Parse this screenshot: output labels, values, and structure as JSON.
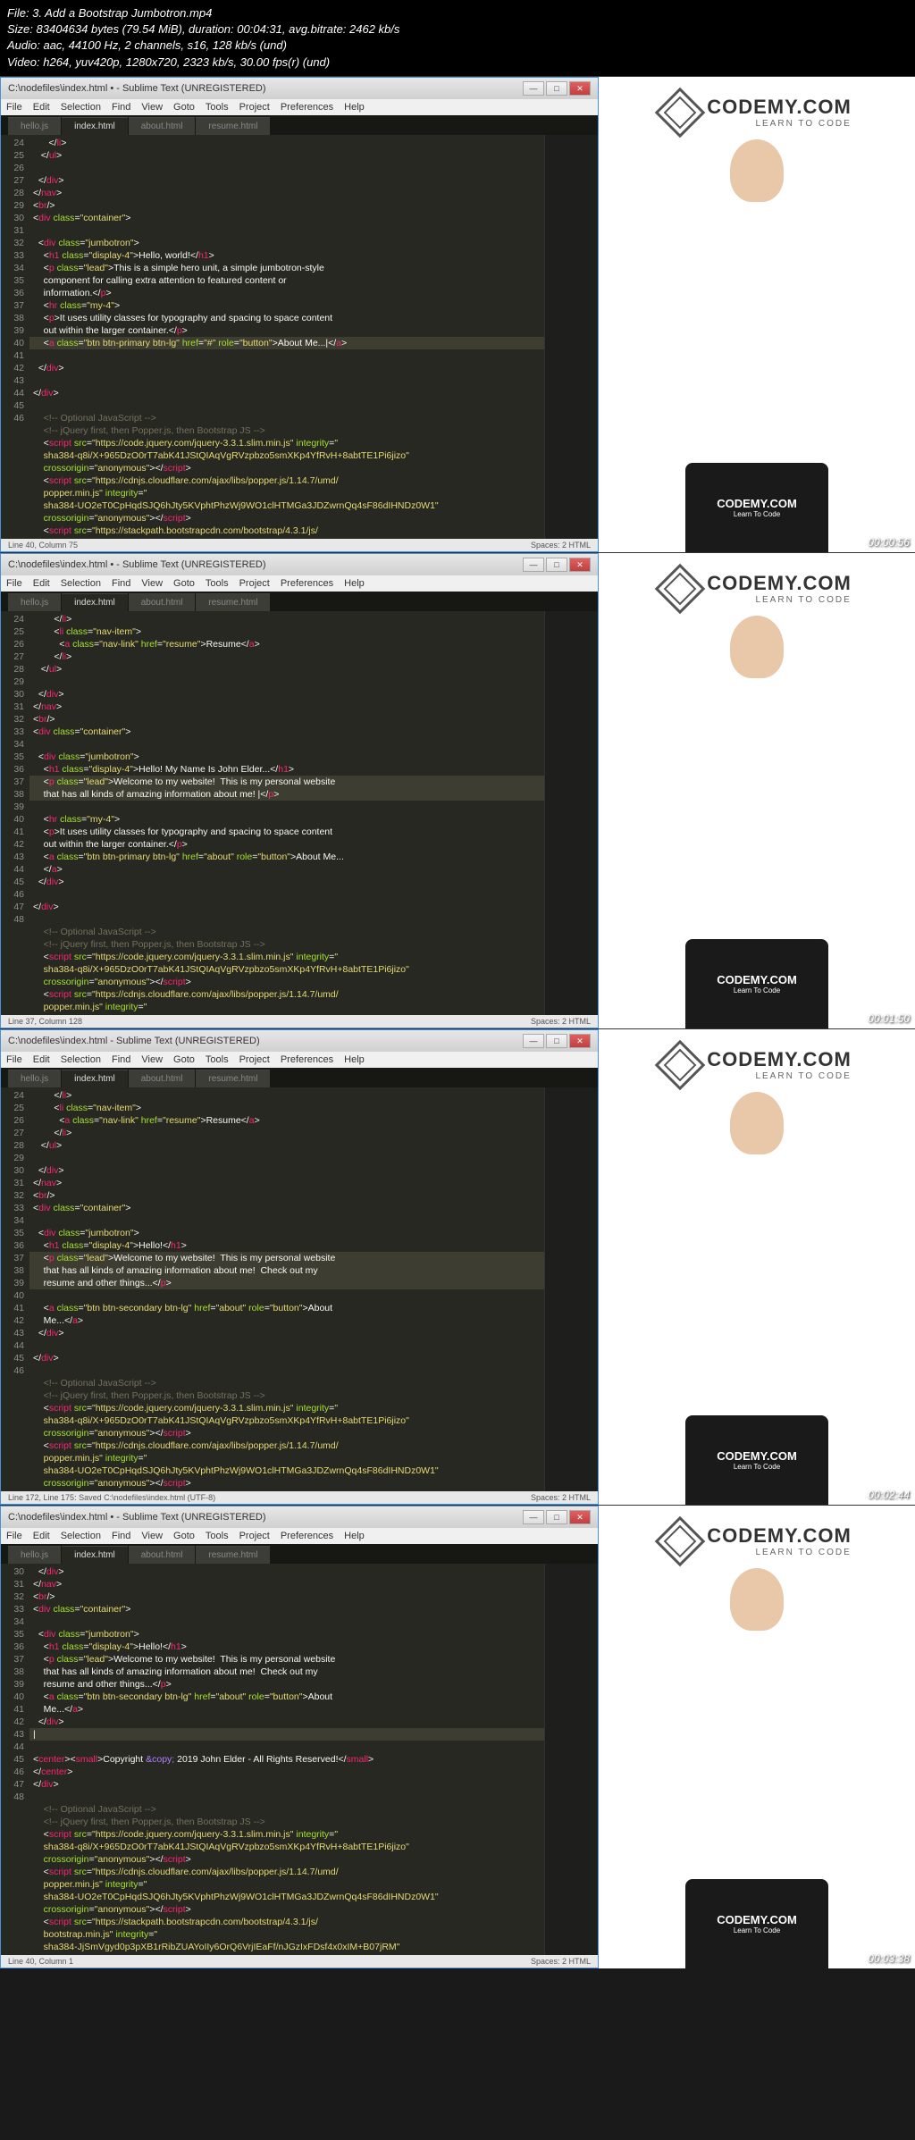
{
  "meta": {
    "file": "File: 3. Add a Bootstrap Jumbotron.mp4",
    "size": "Size: 83404634 bytes (79.54 MiB), duration: 00:04:31, avg.bitrate: 2462 kb/s",
    "audio": "Audio: aac, 44100 Hz, 2 channels, s16, 128 kb/s (und)",
    "video": "Video: h264, yuv420p, 1280x720, 2323 kb/s, 30.00 fps(r) (und)"
  },
  "menus": [
    "File",
    "Edit",
    "Selection",
    "Find",
    "View",
    "Goto",
    "Tools",
    "Project",
    "Preferences",
    "Help"
  ],
  "tabs": [
    "hello.js",
    "index.html",
    "about.html",
    "resume.html"
  ],
  "logo": {
    "main": "CODEMY.COM",
    "sub": "LEARN TO CODE"
  },
  "tshirt": {
    "main": "CODEMY.COM",
    "sub": "Learn To Code"
  },
  "frames": [
    {
      "title": "C:\\nodefiles\\index.html • - Sublime Text (UNREGISTERED)",
      "timestamp": "00:00:56",
      "status_left": "Line 40, Column 75",
      "status_right": "Spaces: 2    HTML",
      "start": 24,
      "code": [
        "      <span class='t-white'>&lt;/</span><span class='t-red'>li</span><span class='t-white'>&gt;</span>",
        "   <span class='t-white'>&lt;/</span><span class='t-red'>ul</span><span class='t-white'>&gt;</span>",
        "",
        "  <span class='t-white'>&lt;/</span><span class='t-red'>div</span><span class='t-white'>&gt;</span>",
        "<span class='t-white'>&lt;/</span><span class='t-red'>nav</span><span class='t-white'>&gt;</span>",
        "<span class='t-white'>&lt;</span><span class='t-red'>br</span><span class='t-white'>/&gt;</span>",
        "<span class='t-white'>&lt;</span><span class='t-red'>div</span> <span class='t-green'>class</span>=<span class='t-yellow'>\"container\"</span><span class='t-white'>&gt;</span>",
        "",
        "  <span class='t-white'>&lt;</span><span class='t-red'>div</span> <span class='t-green'>class</span>=<span class='t-yellow'>\"jumbotron\"</span><span class='t-white'>&gt;</span>",
        "    <span class='t-white'>&lt;</span><span class='t-red'>h1</span> <span class='t-green'>class</span>=<span class='t-yellow'>\"display-4\"</span><span class='t-white'>&gt;Hello, world!&lt;/</span><span class='t-red'>h1</span><span class='t-white'>&gt;</span>",
        "    <span class='t-white'>&lt;</span><span class='t-red'>p</span> <span class='t-green'>class</span>=<span class='t-yellow'>\"lead\"</span><span class='t-white'>&gt;This is a simple hero unit, a simple jumbotron-style</span>\n    <span class='t-white'>component for calling extra attention to featured content or</span>\n    <span class='t-white'>information.&lt;/</span><span class='t-red'>p</span><span class='t-white'>&gt;</span>",
        "    <span class='t-white'>&lt;</span><span class='t-red'>hr</span> <span class='t-green'>class</span>=<span class='t-yellow'>\"my-4\"</span><span class='t-white'>&gt;</span>",
        "    <span class='t-white'>&lt;</span><span class='t-red'>p</span><span class='t-white'>&gt;It uses utility classes for typography and spacing to space content</span>\n    <span class='t-white'>out within the larger container.&lt;/</span><span class='t-red'>p</span><span class='t-white'>&gt;</span>",
        "<span class='hl-line'>    <span class='t-white'>&lt;</span><span class='t-red'>a</span> <span class='t-green'>class</span>=<span class='t-yellow'>\"btn btn-primary btn-lg\"</span> <span class='t-green'>href</span>=<span class='t-yellow'>\"#\"</span> <span class='t-green'>role</span>=<span class='t-yellow'>\"button\"</span><span class='t-white'>&gt;About Me...|&lt;/</span><span class='t-red'>a</span><span class='t-white'>&gt;</span></span>",
        "  <span class='t-white'>&lt;/</span><span class='t-red'>div</span><span class='t-white'>&gt;</span>",
        "",
        "<span class='t-white'>&lt;/</span><span class='t-red'>div</span><span class='t-white'>&gt;</span>",
        "",
        "    <span class='t-comment'>&lt;!-- Optional JavaScript --&gt;</span>",
        "    <span class='t-comment'>&lt;!-- jQuery first, then Popper.js, then Bootstrap JS --&gt;</span>",
        "    <span class='t-white'>&lt;</span><span class='t-red'>script</span> <span class='t-green'>src</span>=<span class='t-yellow'>\"https://code.jquery.com/jquery-3.3.1.slim.min.js\"</span> <span class='t-green'>integrity</span>=<span class='t-yellow'>\"</span>\n    <span class='t-yellow'>sha384-q8i/X+965DzO0rT7abK41JStQIAqVgRVzpbzo5smXKp4YfRvH+8abtTE1Pi6jizo\"</span>\n    <span class='t-green'>crossorigin</span>=<span class='t-yellow'>\"anonymous\"</span><span class='t-white'>&gt;&lt;/</span><span class='t-red'>script</span><span class='t-white'>&gt;</span>",
        "    <span class='t-white'>&lt;</span><span class='t-red'>script</span> <span class='t-green'>src</span>=<span class='t-yellow'>\"https://cdnjs.cloudflare.com/ajax/libs/popper.js/1.14.7/umd/</span>\n    <span class='t-yellow'>popper.min.js\"</span> <span class='t-green'>integrity</span>=<span class='t-yellow'>\"</span>\n    <span class='t-yellow'>sha384-UO2eT0CpHqdSJQ6hJty5KVphtPhzWj9WO1clHTMGa3JDZwrnQq4sF86dIHNDz0W1\"</span>\n    <span class='t-green'>crossorigin</span>=<span class='t-yellow'>\"anonymous\"</span><span class='t-white'>&gt;&lt;/</span><span class='t-red'>script</span><span class='t-white'>&gt;</span>",
        "    <span class='t-white'>&lt;</span><span class='t-red'>script</span> <span class='t-green'>src</span>=<span class='t-yellow'>\"https://stackpath.bootstrapcdn.com/bootstrap/4.3.1/js/</span>"
      ]
    },
    {
      "title": "C:\\nodefiles\\index.html • - Sublime Text (UNREGISTERED)",
      "timestamp": "00:01:50",
      "status_left": "Line 37, Column 128",
      "status_right": "Spaces: 2    HTML",
      "start": 24,
      "code": [
        "        <span class='t-white'>&lt;/</span><span class='t-red'>li</span><span class='t-white'>&gt;</span>",
        "        <span class='t-white'>&lt;</span><span class='t-red'>li</span> <span class='t-green'>class</span>=<span class='t-yellow'>\"nav-item\"</span><span class='t-white'>&gt;</span>",
        "          <span class='t-white'>&lt;</span><span class='t-red'>a</span> <span class='t-green'>class</span>=<span class='t-yellow'>\"nav-link\"</span> <span class='t-green'>href</span>=<span class='t-yellow'>\"resume\"</span><span class='t-white'>&gt;Resume&lt;/</span><span class='t-red'>a</span><span class='t-white'>&gt;</span>",
        "        <span class='t-white'>&lt;/</span><span class='t-red'>li</span><span class='t-white'>&gt;</span>",
        "   <span class='t-white'>&lt;/</span><span class='t-red'>ul</span><span class='t-white'>&gt;</span>",
        "",
        "  <span class='t-white'>&lt;/</span><span class='t-red'>div</span><span class='t-white'>&gt;</span>",
        "<span class='t-white'>&lt;/</span><span class='t-red'>nav</span><span class='t-white'>&gt;</span>",
        "<span class='t-white'>&lt;</span><span class='t-red'>br</span><span class='t-white'>/&gt;</span>",
        "<span class='t-white'>&lt;</span><span class='t-red'>div</span> <span class='t-green'>class</span>=<span class='t-yellow'>\"container\"</span><span class='t-white'>&gt;</span>",
        "",
        "  <span class='t-white'>&lt;</span><span class='t-red'>div</span> <span class='t-green'>class</span>=<span class='t-yellow'>\"jumbotron\"</span><span class='t-white'>&gt;</span>",
        "    <span class='t-white'>&lt;</span><span class='t-red'>h1</span> <span class='t-green'>class</span>=<span class='t-yellow'>\"display-4\"</span><span class='t-white'>&gt;Hello! My Name Is John Elder...&lt;/</span><span class='t-red'>h1</span><span class='t-white'>&gt;</span>",
        "<span class='hl-line'>    <span class='t-white'>&lt;</span><span class='t-red'>p</span> <span class='t-green'>class</span>=<span class='t-yellow'>\"lead\"</span><span class='t-white'>&gt;Welcome to my website!  This is my personal website</span>\n    <span class='t-white'>that has all kinds of amazing information about me! |&lt;/</span><span class='t-red'>p</span><span class='t-white'>&gt;</span></span>",
        "    <span class='t-white'>&lt;</span><span class='t-red'>hr</span> <span class='t-green'>class</span>=<span class='t-yellow'>\"my-4\"</span><span class='t-white'>&gt;</span>",
        "    <span class='t-white'>&lt;</span><span class='t-red'>p</span><span class='t-white'>&gt;It uses utility classes for typography and spacing to space content</span>\n    <span class='t-white'>out within the larger container.&lt;/</span><span class='t-red'>p</span><span class='t-white'>&gt;</span>",
        "    <span class='t-white'>&lt;</span><span class='t-red'>a</span> <span class='t-green'>class</span>=<span class='t-yellow'>\"btn btn-primary btn-lg\"</span> <span class='t-green'>href</span>=<span class='t-yellow'>\"about\"</span> <span class='t-green'>role</span>=<span class='t-yellow'>\"button\"</span><span class='t-white'>&gt;About Me...</span>\n    <span class='t-white'>&lt;/</span><span class='t-red'>a</span><span class='t-white'>&gt;</span>",
        "  <span class='t-white'>&lt;/</span><span class='t-red'>div</span><span class='t-white'>&gt;</span>",
        "",
        "<span class='t-white'>&lt;/</span><span class='t-red'>div</span><span class='t-white'>&gt;</span>",
        "",
        "    <span class='t-comment'>&lt;!-- Optional JavaScript --&gt;</span>",
        "    <span class='t-comment'>&lt;!-- jQuery first, then Popper.js, then Bootstrap JS --&gt;</span>",
        "    <span class='t-white'>&lt;</span><span class='t-red'>script</span> <span class='t-green'>src</span>=<span class='t-yellow'>\"https://code.jquery.com/jquery-3.3.1.slim.min.js\"</span> <span class='t-green'>integrity</span>=<span class='t-yellow'>\"</span>\n    <span class='t-yellow'>sha384-q8i/X+965DzO0rT7abK41JStQIAqVgRVzpbzo5smXKp4YfRvH+8abtTE1Pi6jizo\"</span>\n    <span class='t-green'>crossorigin</span>=<span class='t-yellow'>\"anonymous\"</span><span class='t-white'>&gt;&lt;/</span><span class='t-red'>script</span><span class='t-white'>&gt;</span>",
        "    <span class='t-white'>&lt;</span><span class='t-red'>script</span> <span class='t-green'>src</span>=<span class='t-yellow'>\"https://cdnjs.cloudflare.com/ajax/libs/popper.js/1.14.7/umd/</span>\n    <span class='t-yellow'>popper.min.js\"</span> <span class='t-green'>integrity</span>=<span class='t-yellow'>\"</span>"
      ]
    },
    {
      "title": "C:\\nodefiles\\index.html - Sublime Text (UNREGISTERED)",
      "timestamp": "00:02:44",
      "status_left": "Line 172, Line 175: Saved C:\\nodefiles\\index.html (UTF-8)",
      "status_right": "Spaces: 2    HTML",
      "start": 24,
      "code": [
        "        <span class='t-white'>&lt;/</span><span class='t-red'>li</span><span class='t-white'>&gt;</span>",
        "        <span class='t-white'>&lt;</span><span class='t-red'>li</span> <span class='t-green'>class</span>=<span class='t-yellow'>\"nav-item\"</span><span class='t-white'>&gt;</span>",
        "          <span class='t-white'>&lt;</span><span class='t-red'>a</span> <span class='t-green'>class</span>=<span class='t-yellow'>\"nav-link\"</span> <span class='t-green'>href</span>=<span class='t-yellow'>\"resume\"</span><span class='t-white'>&gt;Resume&lt;/</span><span class='t-red'>a</span><span class='t-white'>&gt;</span>",
        "        <span class='t-white'>&lt;/</span><span class='t-red'>li</span><span class='t-white'>&gt;</span>",
        "   <span class='t-white'>&lt;/</span><span class='t-red'>ul</span><span class='t-white'>&gt;</span>",
        "",
        "  <span class='t-white'>&lt;/</span><span class='t-red'>div</span><span class='t-white'>&gt;</span>",
        "<span class='t-white'>&lt;/</span><span class='t-red'>nav</span><span class='t-white'>&gt;</span>",
        "<span class='t-white'>&lt;</span><span class='t-red'>br</span><span class='t-white'>/&gt;</span>",
        "<span class='t-white'>&lt;</span><span class='t-red'>div</span> <span class='t-green'>class</span>=<span class='t-yellow'>\"container\"</span><span class='t-white'>&gt;</span>",
        "",
        "  <span class='t-white'>&lt;</span><span class='t-red'>div</span> <span class='t-green'>class</span>=<span class='t-yellow'>\"jumbotron\"</span><span class='t-white'>&gt;</span>",
        "    <span class='t-white'>&lt;</span><span class='t-red'>h1</span> <span class='t-green'>class</span>=<span class='t-yellow'>\"display-4\"</span><span class='t-white'>&gt;Hello!&lt;/</span><span class='t-red'>h1</span><span class='t-white'>&gt;</span>",
        "<span class='hl-line'>    <span class='t-white'>&lt;</span><span class='t-red'>p</span> <span class='t-green'>class</span>=<span class='t-yellow'>\"lead\"</span><span class='t-white'>&gt;Welcome to my website!  This is my personal website</span>\n    <span class='t-white'>that has all kinds of amazing information about me!  Check out my</span>\n    <span class='t-white'>resume and other things...&lt;/</span><span class='t-red'>p</span><span class='t-white'>&gt;</span></span>",
        "    <span class='t-white'>&lt;</span><span class='t-red'>a</span> <span class='t-green'>class</span>=<span class='t-yellow'>\"btn btn-secondary btn-lg\"</span> <span class='t-green'>href</span>=<span class='t-yellow'>\"about\"</span> <span class='t-green'>role</span>=<span class='t-yellow'>\"button\"</span><span class='t-white'>&gt;About</span>\n    <span class='t-white'>Me...&lt;/</span><span class='t-red'>a</span><span class='t-white'>&gt;</span>",
        "  <span class='t-white'>&lt;/</span><span class='t-red'>div</span><span class='t-white'>&gt;</span>",
        "",
        "<span class='t-white'>&lt;/</span><span class='t-red'>div</span><span class='t-white'>&gt;</span>",
        "",
        "    <span class='t-comment'>&lt;!-- Optional JavaScript --&gt;</span>",
        "    <span class='t-comment'>&lt;!-- jQuery first, then Popper.js, then Bootstrap JS --&gt;</span>",
        "    <span class='t-white'>&lt;</span><span class='t-red'>script</span> <span class='t-green'>src</span>=<span class='t-yellow'>\"https://code.jquery.com/jquery-3.3.1.slim.min.js\"</span> <span class='t-green'>integrity</span>=<span class='t-yellow'>\"</span>\n    <span class='t-yellow'>sha384-q8i/X+965DzO0rT7abK41JStQIAqVgRVzpbzo5smXKp4YfRvH+8abtTE1Pi6jizo\"</span>\n    <span class='t-green'>crossorigin</span>=<span class='t-yellow'>\"anonymous\"</span><span class='t-white'>&gt;&lt;/</span><span class='t-red'>script</span><span class='t-white'>&gt;</span>",
        "    <span class='t-white'>&lt;</span><span class='t-red'>script</span> <span class='t-green'>src</span>=<span class='t-yellow'>\"https://cdnjs.cloudflare.com/ajax/libs/popper.js/1.14.7/umd/</span>\n    <span class='t-yellow'>popper.min.js\"</span> <span class='t-green'>integrity</span>=<span class='t-yellow'>\"</span>\n    <span class='t-yellow'>sha384-UO2eT0CpHqdSJQ6hJty5KVphtPhzWj9WO1clHTMGa3JDZwrnQq4sF86dIHNDz0W1\"</span>\n    <span class='t-green'>crossorigin</span>=<span class='t-yellow'>\"anonymous\"</span><span class='t-white'>&gt;&lt;/</span><span class='t-red'>script</span><span class='t-white'>&gt;</span>"
      ]
    },
    {
      "title": "C:\\nodefiles\\index.html • - Sublime Text (UNREGISTERED)",
      "timestamp": "00:03:38",
      "status_left": "Line 40, Column 1",
      "status_right": "Spaces: 2    HTML",
      "start": 30,
      "code": [
        "  <span class='t-white'>&lt;/</span><span class='t-red'>div</span><span class='t-white'>&gt;</span>",
        "<span class='t-white'>&lt;/</span><span class='t-red'>nav</span><span class='t-white'>&gt;</span>",
        "<span class='t-white'>&lt;</span><span class='t-red'>br</span><span class='t-white'>/&gt;</span>",
        "<span class='t-white'>&lt;</span><span class='t-red'>div</span> <span class='t-green'>class</span>=<span class='t-yellow'>\"container\"</span><span class='t-white'>&gt;</span>",
        "",
        "  <span class='t-white'>&lt;</span><span class='t-red'>div</span> <span class='t-green'>class</span>=<span class='t-yellow'>\"jumbotron\"</span><span class='t-white'>&gt;</span>",
        "    <span class='t-white'>&lt;</span><span class='t-red'>h1</span> <span class='t-green'>class</span>=<span class='t-yellow'>\"display-4\"</span><span class='t-white'>&gt;Hello!&lt;/</span><span class='t-red'>h1</span><span class='t-white'>&gt;</span>",
        "    <span class='t-white'>&lt;</span><span class='t-red'>p</span> <span class='t-green'>class</span>=<span class='t-yellow'>\"lead\"</span><span class='t-white'>&gt;Welcome to my website!  This is my personal website</span>\n    <span class='t-white'>that has all kinds of amazing information about me!  Check out my</span>\n    <span class='t-white'>resume and other things...&lt;/</span><span class='t-red'>p</span><span class='t-white'>&gt;</span>",
        "    <span class='t-white'>&lt;</span><span class='t-red'>a</span> <span class='t-green'>class</span>=<span class='t-yellow'>\"btn btn-secondary btn-lg\"</span> <span class='t-green'>href</span>=<span class='t-yellow'>\"about\"</span> <span class='t-green'>role</span>=<span class='t-yellow'>\"button\"</span><span class='t-white'>&gt;About</span>\n    <span class='t-white'>Me...&lt;/</span><span class='t-red'>a</span><span class='t-white'>&gt;</span>",
        "  <span class='t-white'>&lt;/</span><span class='t-red'>div</span><span class='t-white'>&gt;</span>",
        "<span class='hl-line'>|</span>",
        "<span class='t-white'>&lt;</span><span class='t-red'>center</span><span class='t-white'>&gt;&lt;</span><span class='t-red'>small</span><span class='t-white'>&gt;Copyright </span><span class='t-purple'>&amp;copy;</span><span class='t-white'> 2019 John Elder - All Rights Reserved!&lt;/</span><span class='t-red'>small</span><span class='t-white'>&gt;</span>\n<span class='t-white'>&lt;/</span><span class='t-red'>center</span><span class='t-white'>&gt;</span>",
        "<span class='t-white'>&lt;/</span><span class='t-red'>div</span><span class='t-white'>&gt;</span>",
        "",
        "    <span class='t-comment'>&lt;!-- Optional JavaScript --&gt;</span>",
        "    <span class='t-comment'>&lt;!-- jQuery first, then Popper.js, then Bootstrap JS --&gt;</span>",
        "    <span class='t-white'>&lt;</span><span class='t-red'>script</span> <span class='t-green'>src</span>=<span class='t-yellow'>\"https://code.jquery.com/jquery-3.3.1.slim.min.js\"</span> <span class='t-green'>integrity</span>=<span class='t-yellow'>\"</span>\n    <span class='t-yellow'>sha384-q8i/X+965DzO0rT7abK41JStQIAqVgRVzpbzo5smXKp4YfRvH+8abtTE1Pi6jizo\"</span>\n    <span class='t-green'>crossorigin</span>=<span class='t-yellow'>\"anonymous\"</span><span class='t-white'>&gt;&lt;/</span><span class='t-red'>script</span><span class='t-white'>&gt;</span>",
        "    <span class='t-white'>&lt;</span><span class='t-red'>script</span> <span class='t-green'>src</span>=<span class='t-yellow'>\"https://cdnjs.cloudflare.com/ajax/libs/popper.js/1.14.7/umd/</span>\n    <span class='t-yellow'>popper.min.js\"</span> <span class='t-green'>integrity</span>=<span class='t-yellow'>\"</span>\n    <span class='t-yellow'>sha384-UO2eT0CpHqdSJQ6hJty5KVphtPhzWj9WO1clHTMGa3JDZwrnQq4sF86dIHNDz0W1\"</span>\n    <span class='t-green'>crossorigin</span>=<span class='t-yellow'>\"anonymous\"</span><span class='t-white'>&gt;&lt;/</span><span class='t-red'>script</span><span class='t-white'>&gt;</span>",
        "    <span class='t-white'>&lt;</span><span class='t-red'>script</span> <span class='t-green'>src</span>=<span class='t-yellow'>\"https://stackpath.bootstrapcdn.com/bootstrap/4.3.1/js/</span>\n    <span class='t-yellow'>bootstrap.min.js\"</span> <span class='t-green'>integrity</span>=<span class='t-yellow'>\"</span>\n    <span class='t-yellow'>sha384-JjSmVgyd0p3pXB1rRibZUAYoIIy6OrQ6VrjIEaFf/nJGzIxFDsf4x0xIM+B07jRM\"</span>"
      ]
    }
  ]
}
